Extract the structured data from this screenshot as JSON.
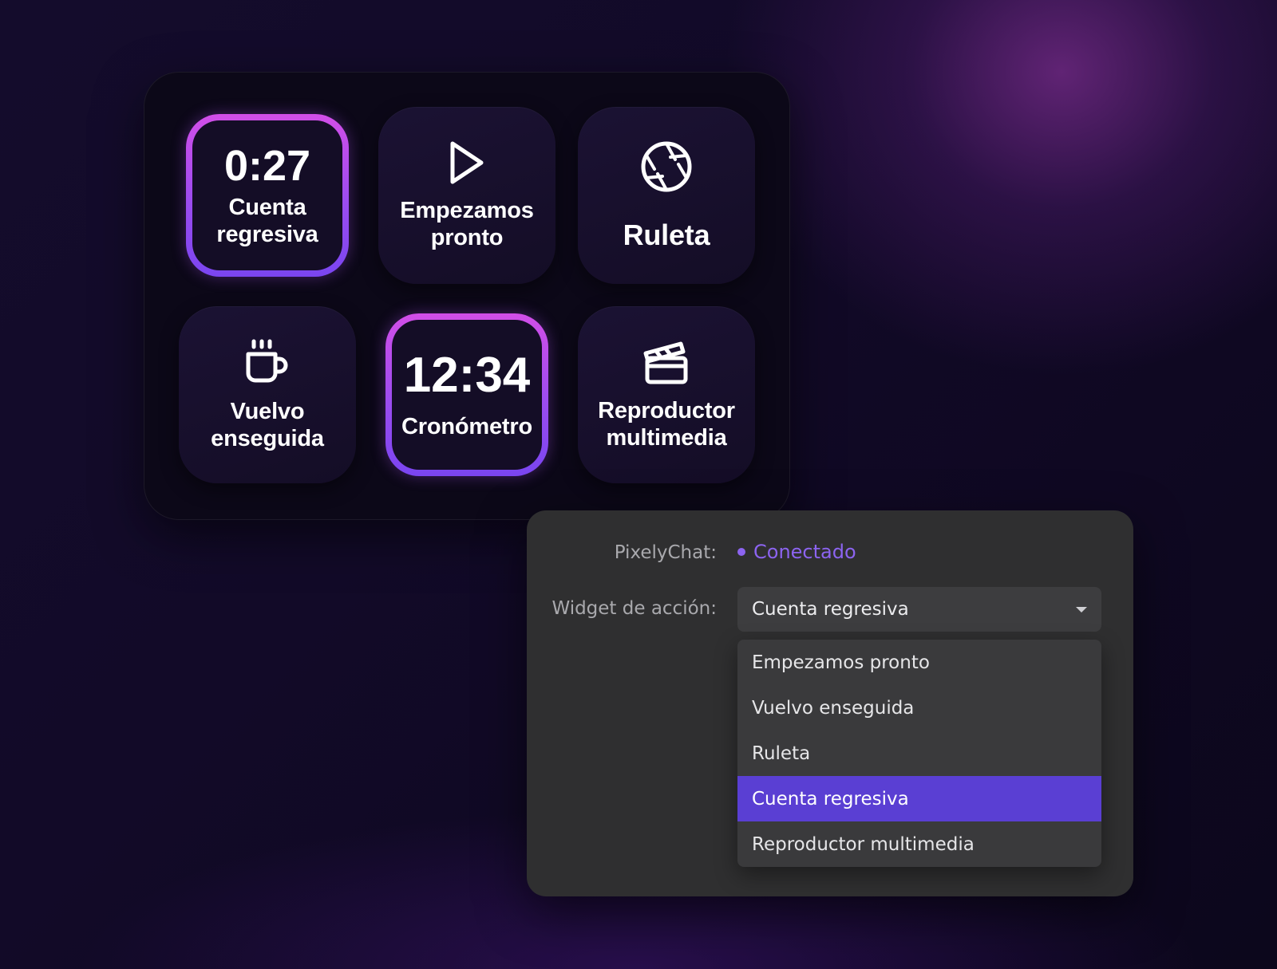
{
  "colors": {
    "accent_purple": "#5a3fd3",
    "status_connected": "#8c64f0",
    "active_border_top": "#d24ee8",
    "active_border_bottom": "#7a45f0"
  },
  "deck": {
    "keys": [
      {
        "value": "0:27",
        "label": "Cuenta\nregresiva",
        "active": true
      },
      {
        "icon": "play-icon",
        "label": "Empezamos\npronto",
        "active": false
      },
      {
        "icon": "aperture-icon",
        "label": "Ruleta",
        "active": false
      },
      {
        "icon": "coffee-cup-icon",
        "label": "Vuelvo\nenseguida",
        "active": false
      },
      {
        "value": "12:34",
        "label": "Cronómetro",
        "active": true
      },
      {
        "icon": "clapperboard-icon",
        "label": "Reproductor\nmultimedia",
        "active": false
      }
    ]
  },
  "settings": {
    "connection_label": "PixelyChat:",
    "connection_status": "Conectado",
    "widget_label": "Widget de acción:",
    "widget_selected": "Cuenta regresiva",
    "options": [
      "Empezamos pronto",
      "Vuelvo enseguida",
      "Ruleta",
      "Cuenta regresiva",
      "Reproductor multimedia"
    ],
    "highlighted_option": "Cuenta regresiva"
  }
}
